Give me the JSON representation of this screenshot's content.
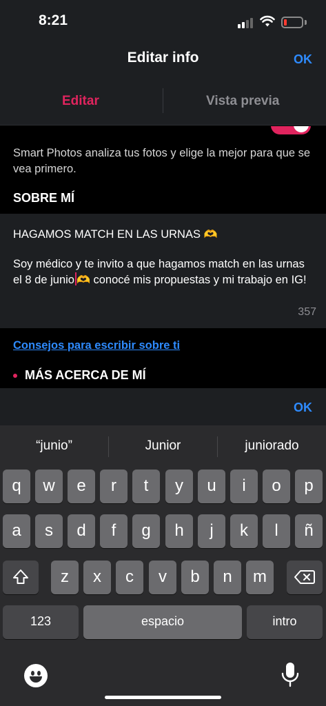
{
  "status_bar": {
    "time": "8:21"
  },
  "nav": {
    "title": "Editar info",
    "ok_label": "OK"
  },
  "tabs": [
    {
      "label": "Editar",
      "active": true
    },
    {
      "label": "Vista previa",
      "active": false
    }
  ],
  "content": {
    "smart_photos_text": "Smart Photos analiza tus fotos y elige la mejor para que se vea primero.",
    "about_title": "SOBRE MÍ",
    "bio_line1": "HAGAMOS MATCH EN LAS URNAS",
    "bio_body_part1": "Soy médico y te invito a que hagamos match en las urnas el 8 de junio",
    "bio_body_part2": " conocé mis propuestas y mi trabajo en IG!",
    "char_count": "357",
    "tips_link": "Consejos para escribir sobre ti",
    "more_title": "MÁS ACERCA DE MÍ"
  },
  "accessory": {
    "ok_label": "OK"
  },
  "keyboard": {
    "suggestions": [
      "“junio”",
      "Junior",
      "juniorado"
    ],
    "row1": [
      "q",
      "w",
      "e",
      "r",
      "t",
      "y",
      "u",
      "i",
      "o",
      "p"
    ],
    "row2": [
      "a",
      "s",
      "d",
      "f",
      "g",
      "h",
      "j",
      "k",
      "l",
      "ñ"
    ],
    "row3": [
      "z",
      "x",
      "c",
      "v",
      "b",
      "n",
      "m"
    ],
    "numbers_label": "123",
    "space_label": "espacio",
    "return_label": "intro"
  },
  "colors": {
    "accent": "#e0245e",
    "link": "#2e8bff"
  },
  "icons": [
    "signal-icon",
    "wifi-icon",
    "battery-icon",
    "heart-hands-emoji",
    "shift-icon",
    "backspace-icon",
    "emoji-icon",
    "microphone-icon"
  ]
}
